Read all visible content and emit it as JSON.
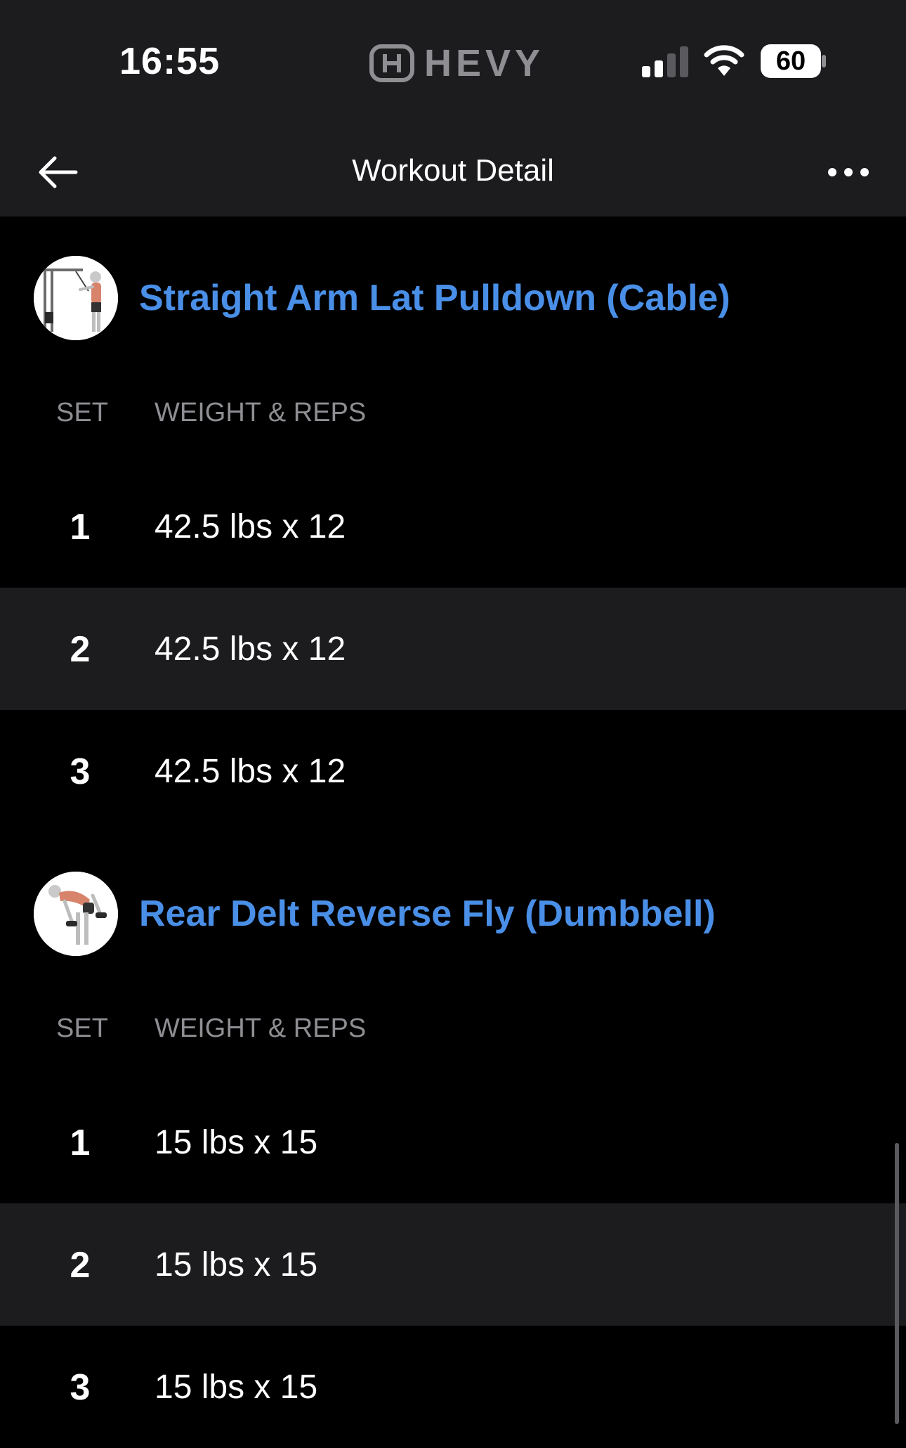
{
  "status_bar": {
    "time": "16:55",
    "app_logo_text": "HEVY",
    "battery": "60",
    "icons": [
      "hevy-logo-icon",
      "cellular-signal-icon",
      "wifi-icon",
      "battery-icon"
    ]
  },
  "nav": {
    "title": "Workout Detail",
    "back_icon": "arrow-left-icon",
    "more_icon": "more-horizontal-icon"
  },
  "columns": {
    "set": "SET",
    "weight_reps": "WEIGHT & REPS"
  },
  "exercises": [
    {
      "name": "Straight Arm Lat Pulldown (Cable)",
      "thumb_icon": "cable-pulldown-thumbnail",
      "sets": [
        {
          "num": "1",
          "value": "42.5 lbs x 12"
        },
        {
          "num": "2",
          "value": "42.5 lbs x 12"
        },
        {
          "num": "3",
          "value": "42.5 lbs x 12"
        }
      ]
    },
    {
      "name": "Rear Delt Reverse Fly (Dumbbell)",
      "thumb_icon": "dumbbell-fly-thumbnail",
      "sets": [
        {
          "num": "1",
          "value": "15 lbs x 15"
        },
        {
          "num": "2",
          "value": "15 lbs x 15"
        },
        {
          "num": "3",
          "value": "15 lbs x 15"
        }
      ]
    }
  ],
  "colors": {
    "accent": "#4a8fe7",
    "background": "#000000",
    "header_bg": "#1c1c1e",
    "alt_row_bg": "#1c1c1e",
    "muted_text": "#8e8e93"
  }
}
